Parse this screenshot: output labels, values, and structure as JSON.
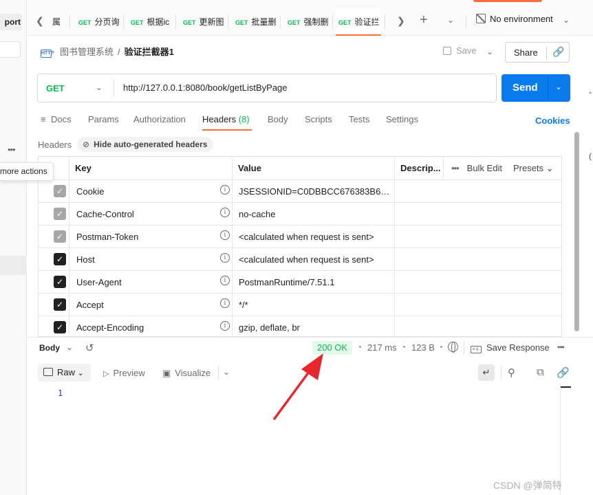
{
  "sidebar": {
    "import_label": "port",
    "more_actions_tooltip": "more actions"
  },
  "tabs": [
    {
      "method": "GET",
      "name": "属"
    },
    {
      "method": "GET",
      "name": "分页询"
    },
    {
      "method": "GET",
      "name": "根据ic"
    },
    {
      "method": "GET",
      "name": "更新图"
    },
    {
      "method": "GET",
      "name": "批量删"
    },
    {
      "method": "GET",
      "name": "强制删"
    },
    {
      "method": "GET",
      "name": "验证拦"
    }
  ],
  "environment": {
    "label": "No environment"
  },
  "breadcrumb": {
    "badge": "HTTP",
    "parent": "图书管理系统",
    "separator": "/",
    "current": "验证拦截器1"
  },
  "toolbar": {
    "save_label": "Save",
    "share_label": "Share"
  },
  "request": {
    "method": "GET",
    "url": "http://127.0.0.1:8080/book/getListByPage",
    "send_label": "Send"
  },
  "request_tabs": {
    "docs": "Docs",
    "params": "Params",
    "authorization": "Authorization",
    "headers": "Headers",
    "headers_count": "(8)",
    "body": "Body",
    "scripts": "Scripts",
    "tests": "Tests",
    "settings": "Settings",
    "cookies": "Cookies"
  },
  "headers_section": {
    "title": "Headers",
    "hide_auto_label": "Hide auto-generated headers",
    "columns": {
      "key": "Key",
      "value": "Value",
      "description": "Descrip...",
      "bulk_edit": "Bulk Edit",
      "presets": "Presets"
    },
    "rows": [
      {
        "checked": true,
        "auto": true,
        "key": "Cookie",
        "value": "JSESSIONID=C0DBBCC676383B668..."
      },
      {
        "checked": true,
        "auto": true,
        "key": "Cache-Control",
        "value": "no-cache"
      },
      {
        "checked": true,
        "auto": true,
        "key": "Postman-Token",
        "value": "<calculated when request is sent>"
      },
      {
        "checked": true,
        "auto": false,
        "key": "Host",
        "value": "<calculated when request is sent>"
      },
      {
        "checked": true,
        "auto": false,
        "key": "User-Agent",
        "value": "PostmanRuntime/7.51.1"
      },
      {
        "checked": true,
        "auto": false,
        "key": "Accept",
        "value": "*/*"
      },
      {
        "checked": true,
        "auto": false,
        "key": "Accept-Encoding",
        "value": "gzip, deflate, br"
      }
    ]
  },
  "response": {
    "body_label": "Body",
    "status": "200 OK",
    "time": "217 ms",
    "size": "123 B",
    "save_response_label": "Save Response",
    "save_response_icon_text": "e.g.",
    "view": {
      "raw": "Raw",
      "preview": "Preview",
      "visualize": "Visualize"
    },
    "line_numbers": [
      "1"
    ]
  },
  "watermark": "CSDN @弹简特",
  "colors": {
    "accent": "#ff6c37",
    "send": "#097bed",
    "get_method": "#0cbb52",
    "annotation_arrow": "#e8262b"
  }
}
